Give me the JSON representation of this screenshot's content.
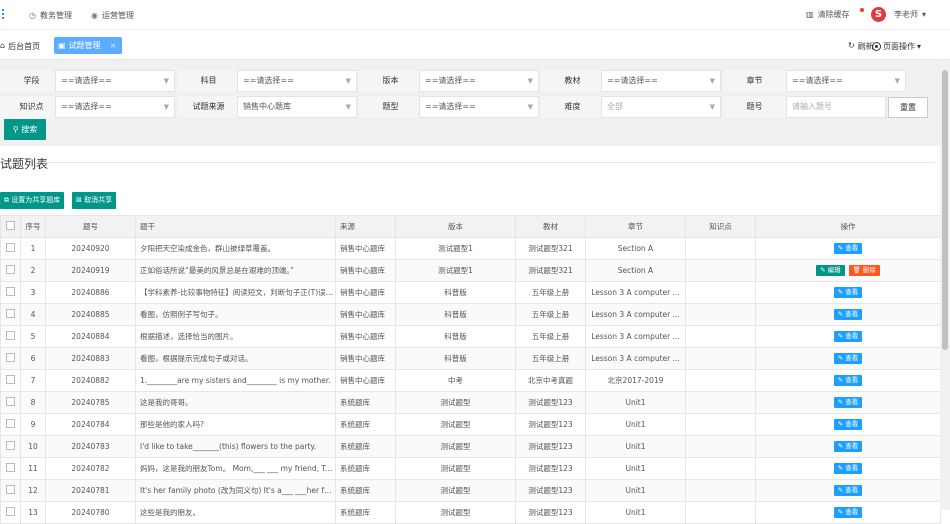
{
  "topnav": {
    "items": [
      {
        "label": "教务管理",
        "icon": "clock-icon"
      },
      {
        "label": "运营管理",
        "icon": "target-icon"
      }
    ],
    "clear_cache": "清除缓存",
    "user": "李老师",
    "logo_letter": "S"
  },
  "tabs": {
    "home": "后台首页",
    "active": "试题管理",
    "refresh": "刷新",
    "page_ops": "页面操作"
  },
  "filters": {
    "row1": [
      {
        "label": "学段",
        "value": "==请选择=="
      },
      {
        "label": "科目",
        "value": "==请选择=="
      },
      {
        "label": "版本",
        "value": "==请选择=="
      },
      {
        "label": "教材",
        "value": "==请选择=="
      },
      {
        "label": "章节",
        "value": "==请选择=="
      }
    ],
    "row2": [
      {
        "label": "知识点",
        "value": "==请选择=="
      },
      {
        "label": "试题来源",
        "value": "销售中心题库"
      },
      {
        "label": "题型",
        "value": "==请选择=="
      },
      {
        "label": "难度",
        "value": "全部"
      },
      {
        "label": "题号",
        "placeholder": "请输入题号"
      }
    ],
    "reset": "重置",
    "search": "搜索"
  },
  "list": {
    "title": "试题列表",
    "set_shared": "设置为共享题库",
    "cancel_shared": "取消共享",
    "columns": [
      "序号",
      "题号",
      "题干",
      "来源",
      "版本",
      "教材",
      "章节",
      "知识点",
      "操作"
    ],
    "view": "查看",
    "edit": "编辑",
    "delete": "删除",
    "rows": [
      {
        "no": "1",
        "id": "20240920",
        "stem": "夕阳把天空染成金色，群山被绿草覆盖。",
        "source": "销售中心题库",
        "version": "测试题型1",
        "book": "测试题型321",
        "chapter": "Section A",
        "kp": "",
        "ops": "view"
      },
      {
        "no": "2",
        "id": "20240919",
        "stem": "正如俗话所说“最美的风景总是在艰难的顶端。”",
        "source": "销售中心题库",
        "version": "测试题型1",
        "book": "测试题型321",
        "chapter": "Section A",
        "kp": "",
        "ops": "edit"
      },
      {
        "no": "3",
        "id": "20240886",
        "stem": "【学科素养-比较事物特征】阅读短文，判断句子正(T)误(F)",
        "source": "销售中心题库",
        "version": "科普版",
        "book": "五年级上册",
        "chapter": "Lesson 3 A computer ...",
        "kp": "",
        "ops": "view"
      },
      {
        "no": "4",
        "id": "20240885",
        "stem": "看图，仿照例子写句子。",
        "source": "销售中心题库",
        "version": "科普版",
        "book": "五年级上册",
        "chapter": "Lesson 3 A computer ...",
        "kp": "",
        "ops": "view"
      },
      {
        "no": "5",
        "id": "20240884",
        "stem": "根据描述，选择恰当的图片。",
        "source": "销售中心题库",
        "version": "科普版",
        "book": "五年级上册",
        "chapter": "Lesson 3 A computer ...",
        "kp": "",
        "ops": "view"
      },
      {
        "no": "6",
        "id": "20240883",
        "stem": "看图，根据提示完成句子或对话。",
        "source": "销售中心题库",
        "version": "科普版",
        "book": "五年级上册",
        "chapter": "Lesson 3 A computer ...",
        "kp": "",
        "ops": "view"
      },
      {
        "no": "7",
        "id": "20240882",
        "stem": "1.________are my sisters and________ is my mother.",
        "source": "销售中心题库",
        "version": "中考",
        "book": "北京中考真题",
        "chapter": "北京2017-2019",
        "kp": "",
        "ops": "view"
      },
      {
        "no": "8",
        "id": "20240785",
        "stem": "这是我的哥哥。",
        "source": "系统题库",
        "version": "测试题型",
        "book": "测试题型123",
        "chapter": "Unit1",
        "kp": "",
        "ops": "view"
      },
      {
        "no": "9",
        "id": "20240784",
        "stem": "那些是他的家人吗?",
        "source": "系统题库",
        "version": "测试题型",
        "book": "测试题型123",
        "chapter": "Unit1",
        "kp": "",
        "ops": "view"
      },
      {
        "no": "10",
        "id": "20240783",
        "stem": "I'd like to take_______(this) flowers to the party.",
        "source": "系统题库",
        "version": "测试题型",
        "book": "测试题型123",
        "chapter": "Unit1",
        "kp": "",
        "ops": "view"
      },
      {
        "no": "11",
        "id": "20240782",
        "stem": "妈妈，这是我的朋友Tom。 Mom,___ ___ my friend, Tom.",
        "source": "系统题库",
        "version": "测试题型",
        "book": "测试题型123",
        "chapter": "Unit1",
        "kp": "",
        "ops": "view"
      },
      {
        "no": "12",
        "id": "20240781",
        "stem": "It's her family photo (改为同义句)   It's a___ ___her family.",
        "source": "系统题库",
        "version": "测试题型",
        "book": "测试题型123",
        "chapter": "Unit1",
        "kp": "",
        "ops": "view"
      },
      {
        "no": "13",
        "id": "20240780",
        "stem": "这些是我的朋友。",
        "source": "系统题库",
        "version": "测试题型",
        "book": "测试题型123",
        "chapter": "Unit1",
        "kp": "",
        "ops": "view"
      }
    ]
  }
}
